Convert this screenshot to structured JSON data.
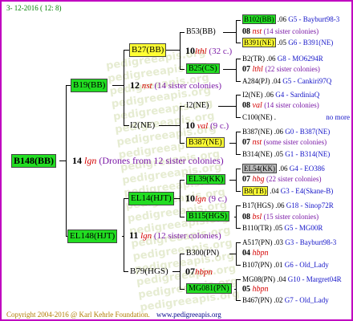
{
  "header": {
    "date": "3- 12-2016 ( 12: 8)"
  },
  "footer": {
    "copyright": "Copyright 2004-2016 @ Karl Kehrle Foundation.",
    "site": "www.pedigreeapis.org"
  },
  "watermark": "pedigreeapis.org",
  "root": {
    "name": "B148(BB)",
    "num": "14",
    "sym": "lgn",
    "note": "(Drones from 12 sister colonies)"
  },
  "g1": [
    {
      "name": "B19(BB)",
      "num": "12",
      "sym": "nst",
      "note": "(14 sister colonies)"
    },
    {
      "name": "EL148(HJT)",
      "num": "11",
      "sym": "lgn",
      "note": "(12 sister colonies)"
    }
  ],
  "g2": [
    {
      "name": "B27(BB)",
      "num": "10",
      "sym": "lthl",
      "note": "(32 c.)"
    },
    {
      "name": "I2(NE)",
      "num": "10",
      "sym": "val",
      "note": "(9 c.)"
    },
    {
      "name": "EL14(HJT)",
      "num": "10",
      "sym": "lgn",
      "note": "(9 c.)"
    },
    {
      "name": "B79(HGS)",
      "num": "07",
      "sym": "hbpn",
      "note": ""
    }
  ],
  "g3": [
    {
      "name": "B53(BB)",
      "num": "08",
      "sym": "nst",
      "note": "(14 sister colonies)"
    },
    {
      "name": "B25(CS)",
      "num": "07",
      "sym": "lthl",
      "note": "(22 sister colonies)"
    },
    {
      "name": "I2(NE)",
      "num": "08",
      "sym": "val",
      "note": "(14 sister colonies)"
    },
    {
      "name": "B387(NE)",
      "num": "07",
      "sym": "nst",
      "note": "(some sister colonies)"
    },
    {
      "name": "EL39(KK)",
      "num": "07",
      "sym": "hbg",
      "note": "(22 sister colonies)"
    },
    {
      "name": "B115(HGS)",
      "num": "08",
      "sym": "bsl",
      "note": "(15 sister colonies)"
    },
    {
      "name": "B300(PN)",
      "num": "04",
      "sym": "hbpn",
      "note": ""
    },
    {
      "name": "MG081(PN)",
      "num": "05",
      "sym": "hbpn",
      "note": ""
    }
  ],
  "g4": [
    {
      "name": "B102(BB)",
      "year": ".06",
      "info": "G5 - Bayburt98-3"
    },
    {
      "name": "B391(NE)",
      "year": ".05",
      "info": "G6 - B391(NE)"
    },
    {
      "name": "B2(TR)",
      "year": ".06",
      "info": "G8 - MO6294R"
    },
    {
      "name": "A284(PJ)",
      "year": ".04",
      "info": "G5 - Cankiri97Q"
    },
    {
      "name": "I2(NE)",
      "year": ".06",
      "info": "G4 - SardiniaQ"
    },
    {
      "name": "C100(NE)",
      "year": ".",
      "info": "no more"
    },
    {
      "name": "B387(NE)",
      "year": ".06",
      "info": "G0 - B387(NE)"
    },
    {
      "name": "B314(NE)",
      "year": ".05",
      "info": "G1 - B314(NE)"
    },
    {
      "name": "EL54(KK)",
      "year": ".06",
      "info": "G4 - EO386"
    },
    {
      "name": "B8(TB)",
      "year": ".04",
      "info": "G3 - E4(Skane-B)"
    },
    {
      "name": "B17(HGS)",
      "year": ".06",
      "info": "G18 - Sinop72R"
    },
    {
      "name": "B110(TR)",
      "year": ".05",
      "info": "G5 - MG00R"
    },
    {
      "name": "A517(PN)",
      "year": ".03",
      "info": "G3 - Bayburt98-3"
    },
    {
      "name": "B107(PN)",
      "year": ".01",
      "info": "G6 - Old_Lady"
    },
    {
      "name": "MG08(PN)",
      "year": ".04",
      "info": "G10 - Margret04R"
    },
    {
      "name": "B467(PN)",
      "year": ".02",
      "info": "G7 - Old_Lady"
    }
  ]
}
